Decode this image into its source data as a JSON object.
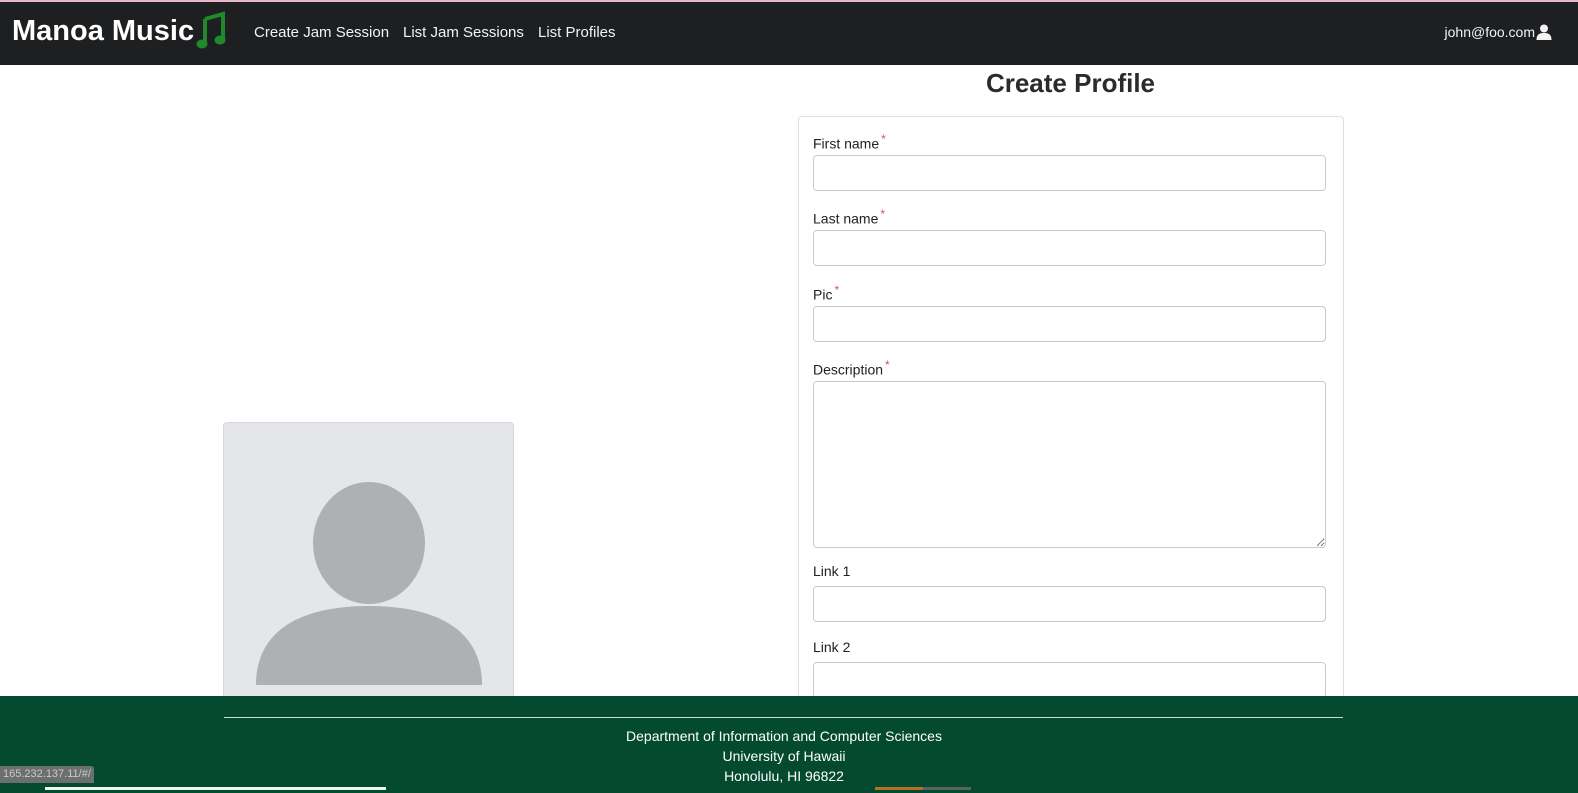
{
  "navbar": {
    "brand": "Manoa Music",
    "brand_icon": "music-note-icon",
    "links": [
      "Create Jam Session",
      "List Jam Sessions",
      "List Profiles"
    ],
    "user_email": "john@foo.com",
    "user_icon": "user-icon"
  },
  "page": {
    "title": "Create Profile",
    "avatar_icon": "avatar-placeholder-icon"
  },
  "form": {
    "fields": [
      {
        "label": "First name",
        "required": "*",
        "value": ""
      },
      {
        "label": "Last name",
        "required": "*",
        "value": ""
      },
      {
        "label": "Pic",
        "required": "*",
        "value": ""
      },
      {
        "label": "Description",
        "required": "*",
        "value": ""
      },
      {
        "label": "Link 1",
        "value": ""
      },
      {
        "label": "Link 2",
        "value": ""
      }
    ]
  },
  "footer": {
    "lines": [
      "Department of Information and Computer Sciences",
      "University of Hawaii",
      "Honolulu, HI 96822"
    ]
  },
  "status_url": "165.232.137.11/#/",
  "colors": {
    "navbar_bg": "#1e1f21",
    "footer_bg": "#044a30",
    "brand_note": "#1f8a2b",
    "required": "#d9534f"
  }
}
